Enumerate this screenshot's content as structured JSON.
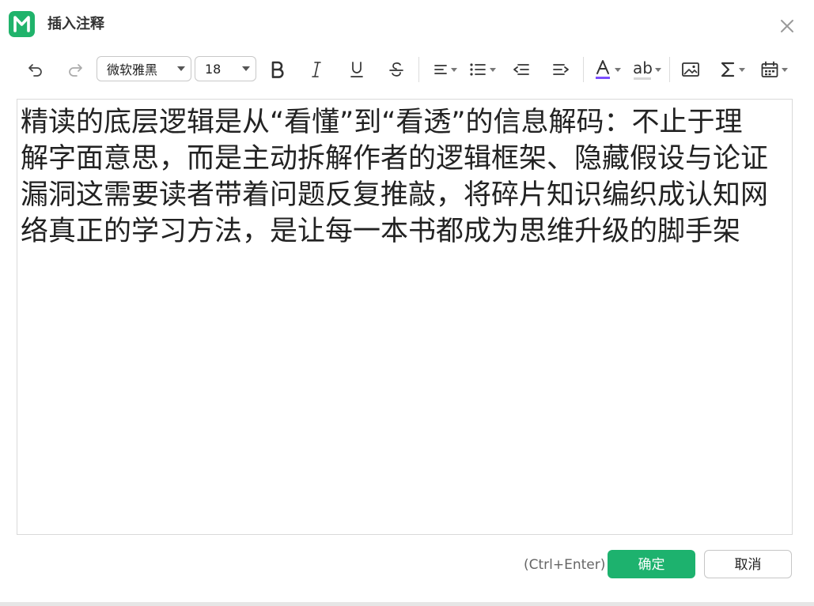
{
  "dialog": {
    "title": "插入注释",
    "accent_color": "#1db26e"
  },
  "toolbar": {
    "undo_icon": "undo-icon",
    "redo_icon": "redo-icon",
    "font_family": "微软雅黑",
    "font_size": "18",
    "bold_icon": "bold-icon",
    "italic_icon": "italic-icon",
    "underline_icon": "underline-icon",
    "strikethrough_icon": "strikethrough-icon",
    "align_icon": "align-icon",
    "list_icon": "bullet-list-icon",
    "outdent_icon": "outdent-icon",
    "indent_icon": "indent-icon",
    "font_color_icon": "font-color-icon",
    "font_color_value": "#7b4dff",
    "highlight_label": "ab",
    "image_icon": "image-icon",
    "formula_icon": "formula-icon",
    "date_icon": "calendar-icon"
  },
  "editor": {
    "content": "精读的底层逻辑是从“看懂”到“看透”的信息解码：不止于理解字面意思，而是主动拆解作者的逻辑框架、隐藏假设与论证漏洞这需要读者带着问题反复推敲，将碎片知识编织成认知网络真正的学习方法，是让每一本书都成为思维升级的脚手架"
  },
  "footer": {
    "shortcut_hint": "(Ctrl+Enter)",
    "confirm_label": "确定",
    "cancel_label": "取消"
  }
}
